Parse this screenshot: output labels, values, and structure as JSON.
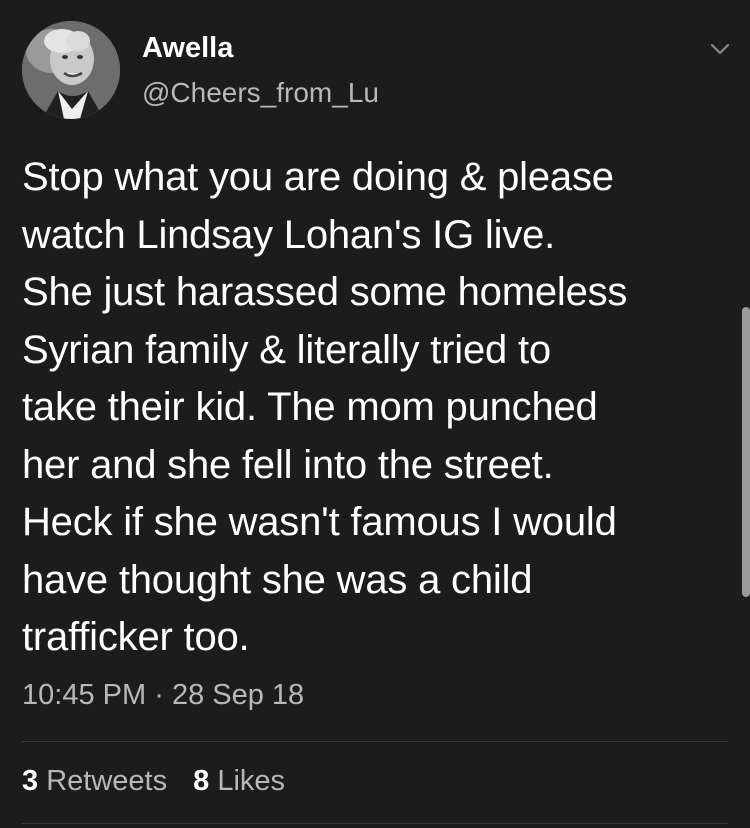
{
  "tweet": {
    "display_name": "Awella",
    "handle": "@Cheers_from_Lu",
    "text": "Stop what you are doing & please\nwatch Lindsay Lohan's IG live.\nShe just harassed some homeless\nSyrian family & literally tried to\ntake their kid.  The mom punched\nher and she fell into the street.\nHeck if she wasn't famous I would\nhave thought she was a child\ntrafficker too.",
    "time": "10:45 PM",
    "separator": "·",
    "date": "28 Sep 18",
    "retweets_count": "3",
    "retweets_label": "Retweets",
    "likes_count": "8",
    "likes_label": "Likes"
  },
  "icons": {
    "menu": "chevron-down-icon",
    "avatar": "avatar"
  },
  "colors": {
    "background": "#1c1c1c",
    "primary_text": "#ffffff",
    "secondary_text": "#b8b8b8",
    "divider": "#3a3a3a"
  }
}
